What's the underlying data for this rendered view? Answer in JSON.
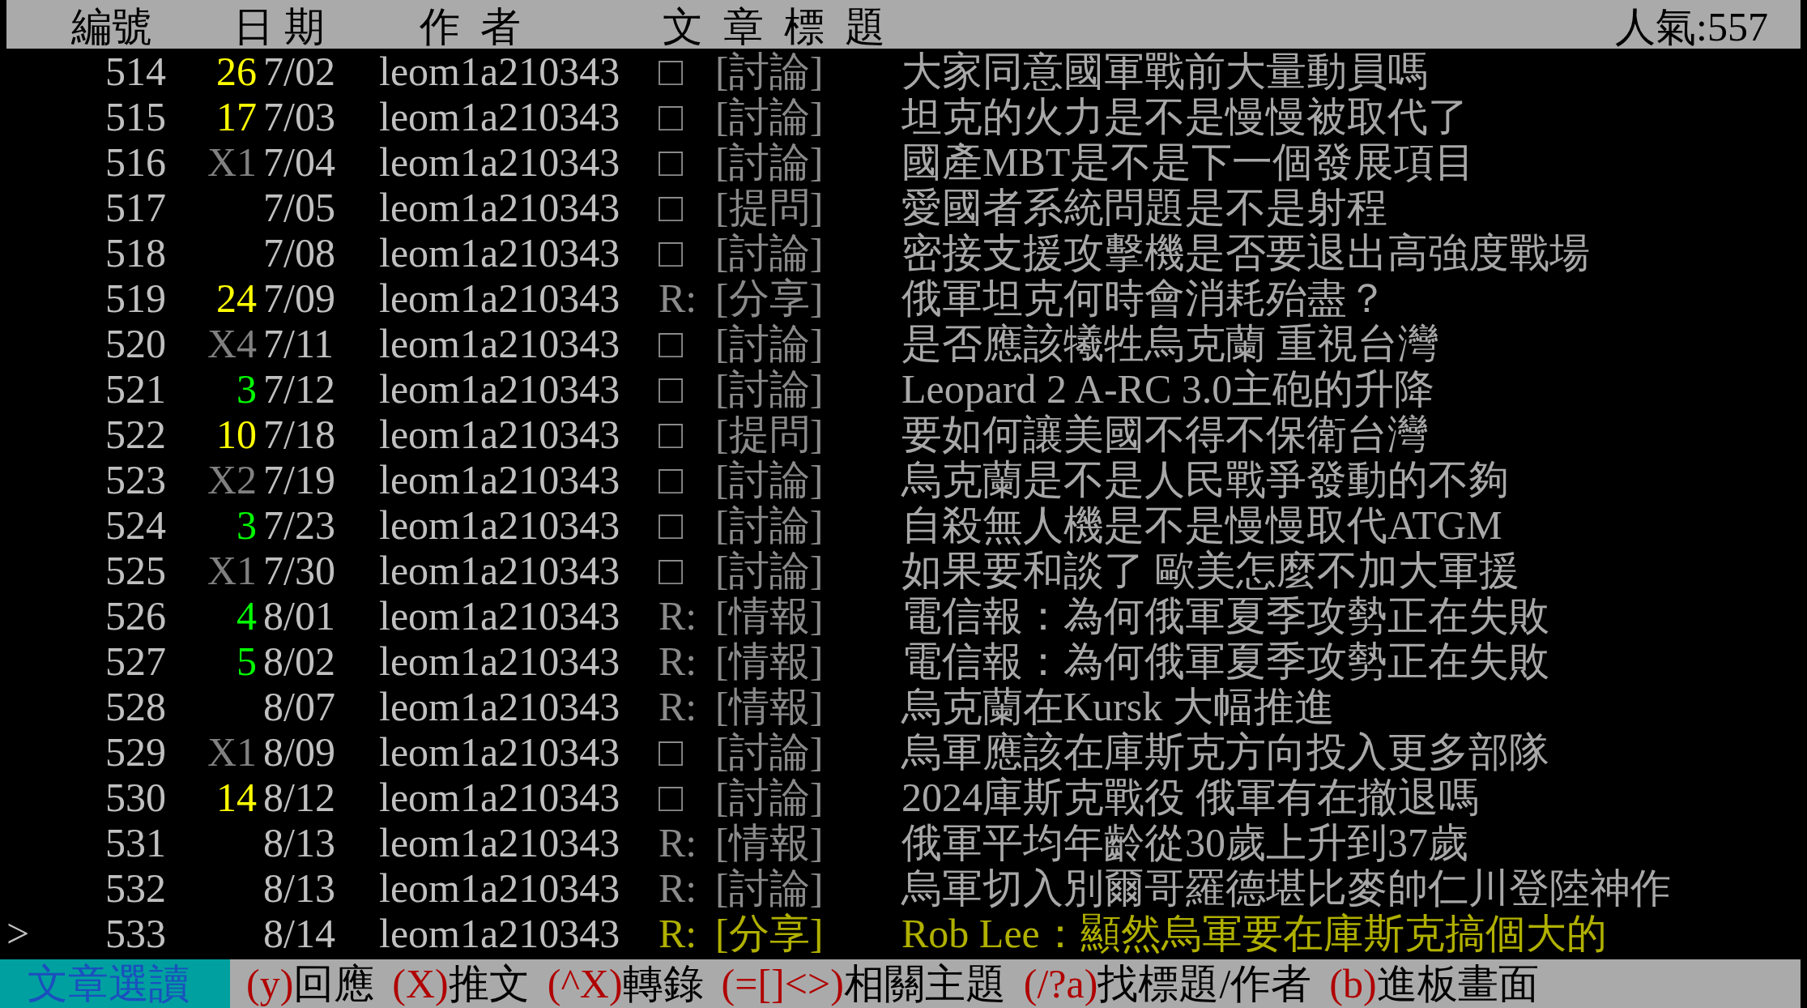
{
  "header": {
    "columns": [
      "編號",
      "日 期",
      "作  者",
      "文  章  標  題"
    ],
    "popularity": "人氣:557"
  },
  "cursor": ">",
  "rows": [
    {
      "number": "514",
      "count": "26",
      "color": "#ffff00",
      "date": "7/02",
      "author": "leom1a210343",
      "mark": "□",
      "category": "[討論]",
      "title": "大家同意國軍戰前大量動員嗎",
      "selected": false
    },
    {
      "number": "515",
      "count": "17",
      "color": "#ffff00",
      "date": "7/03",
      "author": "leom1a210343",
      "mark": "□",
      "category": "[討論]",
      "title": "坦克的火力是不是慢慢被取代了",
      "selected": false
    },
    {
      "number": "516",
      "count": "X1",
      "color": "#808080",
      "date": "7/04",
      "author": "leom1a210343",
      "mark": "□",
      "category": "[討論]",
      "title": "國產MBT是不是下一個發展項目",
      "selected": false
    },
    {
      "number": "517",
      "date": "7/05",
      "author": "leom1a210343",
      "mark": "□",
      "category": "[提問]",
      "title": "愛國者系統問題是不是射程",
      "selected": false
    },
    {
      "number": "518",
      "date": "7/08",
      "author": "leom1a210343",
      "mark": "□",
      "category": "[討論]",
      "title": "密接支援攻擊機是否要退出高強度戰場",
      "selected": false
    },
    {
      "number": "519",
      "count": "24",
      "color": "#ffff00",
      "date": "7/09",
      "author": "leom1a210343",
      "mark": "R:",
      "category": "[分享]",
      "title": "俄軍坦克何時會消耗殆盡？",
      "selected": false
    },
    {
      "number": "520",
      "count": "X4",
      "color": "#808080",
      "date": "7/11",
      "author": "leom1a210343",
      "mark": "□",
      "category": "[討論]",
      "title": "是否應該犧牲烏克蘭 重視台灣",
      "selected": false
    },
    {
      "number": "521",
      "count": "3",
      "color": "#00ff00",
      "date": "7/12",
      "author": "leom1a210343",
      "mark": "□",
      "category": "[討論]",
      "title": "Leopard 2 A-RC 3.0主砲的升降",
      "selected": false
    },
    {
      "number": "522",
      "count": "10",
      "color": "#ffff00",
      "date": "7/18",
      "author": "leom1a210343",
      "mark": "□",
      "category": "[提問]",
      "title": "要如何讓美國不得不保衛台灣",
      "selected": false
    },
    {
      "number": "523",
      "count": "X2",
      "color": "#808080",
      "date": "7/19",
      "author": "leom1a210343",
      "mark": "□",
      "category": "[討論]",
      "title": "烏克蘭是不是人民戰爭發動的不夠",
      "selected": false
    },
    {
      "number": "524",
      "count": "3",
      "color": "#00ff00",
      "date": "7/23",
      "author": "leom1a210343",
      "mark": "□",
      "category": "[討論]",
      "title": "自殺無人機是不是慢慢取代ATGM",
      "selected": false
    },
    {
      "number": "525",
      "count": "X1",
      "color": "#808080",
      "date": "7/30",
      "author": "leom1a210343",
      "mark": "□",
      "category": "[討論]",
      "title": "如果要和談了 歐美怎麼不加大軍援",
      "selected": false
    },
    {
      "number": "526",
      "count": "4",
      "color": "#00ff00",
      "date": "8/01",
      "author": "leom1a210343",
      "mark": "R:",
      "category": "[情報]",
      "title": "電信報：為何俄軍夏季攻勢正在失敗",
      "selected": false
    },
    {
      "number": "527",
      "count": "5",
      "color": "#00ff00",
      "date": "8/02",
      "author": "leom1a210343",
      "mark": "R:",
      "category": "[情報]",
      "title": "電信報：為何俄軍夏季攻勢正在失敗",
      "selected": false
    },
    {
      "number": "528",
      "date": "8/07",
      "author": "leom1a210343",
      "mark": "R:",
      "category": "[情報]",
      "title": "烏克蘭在Kursk 大幅推進",
      "selected": false
    },
    {
      "number": "529",
      "count": "X1",
      "color": "#808080",
      "date": "8/09",
      "author": "leom1a210343",
      "mark": "□",
      "category": "[討論]",
      "title": "烏軍應該在庫斯克方向投入更多部隊",
      "selected": false
    },
    {
      "number": "530",
      "count": "14",
      "color": "#ffff00",
      "date": "8/12",
      "author": "leom1a210343",
      "mark": "□",
      "category": "[討論]",
      "title": "2024庫斯克戰役 俄軍有在撤退嗎",
      "selected": false
    },
    {
      "number": "531",
      "date": "8/13",
      "author": "leom1a210343",
      "mark": "R:",
      "category": "[情報]",
      "title": "俄軍平均年齡從30歲上升到37歲",
      "selected": false
    },
    {
      "number": "532",
      "date": "8/13",
      "author": "leom1a210343",
      "mark": "R:",
      "category": "[討論]",
      "title": "烏軍切入別爾哥羅德堪比麥帥仁川登陸神作",
      "selected": false
    },
    {
      "number": "533",
      "date": "8/14",
      "author": "leom1a210343",
      "mark": "R:",
      "category": "[分享]",
      "title": "Rob Lee：顯然烏軍要在庫斯克搞個大的",
      "selected": true
    }
  ],
  "footer": {
    "mode": "文章選讀",
    "commands": [
      {
        "key": "(y)",
        "label": "回應"
      },
      {
        "key": "(X)",
        "label": "推文"
      },
      {
        "key": "(^X)",
        "label": "轉錄"
      },
      {
        "key": "(=[]<>)",
        "label": "相關主題"
      },
      {
        "key": "(/?a)",
        "label": "找標題/作者"
      },
      {
        "key": "(b)",
        "label": "進板畫面"
      }
    ]
  }
}
